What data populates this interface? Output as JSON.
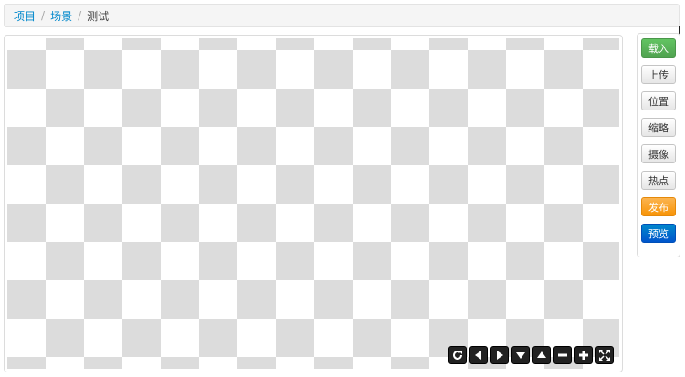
{
  "breadcrumb": {
    "items": [
      "项目",
      "场景"
    ],
    "current": "测试",
    "separator": "/"
  },
  "sidebar": {
    "buttons": [
      {
        "label": "载入",
        "style": "green",
        "color": "#5bb75b"
      },
      {
        "label": "上传",
        "style": "default"
      },
      {
        "label": "位置",
        "style": "default"
      },
      {
        "label": "缩略",
        "style": "default"
      },
      {
        "label": "摄像",
        "style": "default"
      },
      {
        "label": "热点",
        "style": "default"
      },
      {
        "label": "发布",
        "style": "orange",
        "color": "#faa732"
      },
      {
        "label": "预览",
        "style": "blue",
        "color": "#006dcc"
      }
    ]
  },
  "viewer": {
    "background": "checkerboard",
    "controls": [
      "refresh-icon",
      "arrow-left-icon",
      "arrow-right-icon",
      "arrow-down-icon",
      "arrow-up-icon",
      "zoom-out-icon",
      "zoom-in-icon",
      "fullscreen-icon"
    ]
  }
}
